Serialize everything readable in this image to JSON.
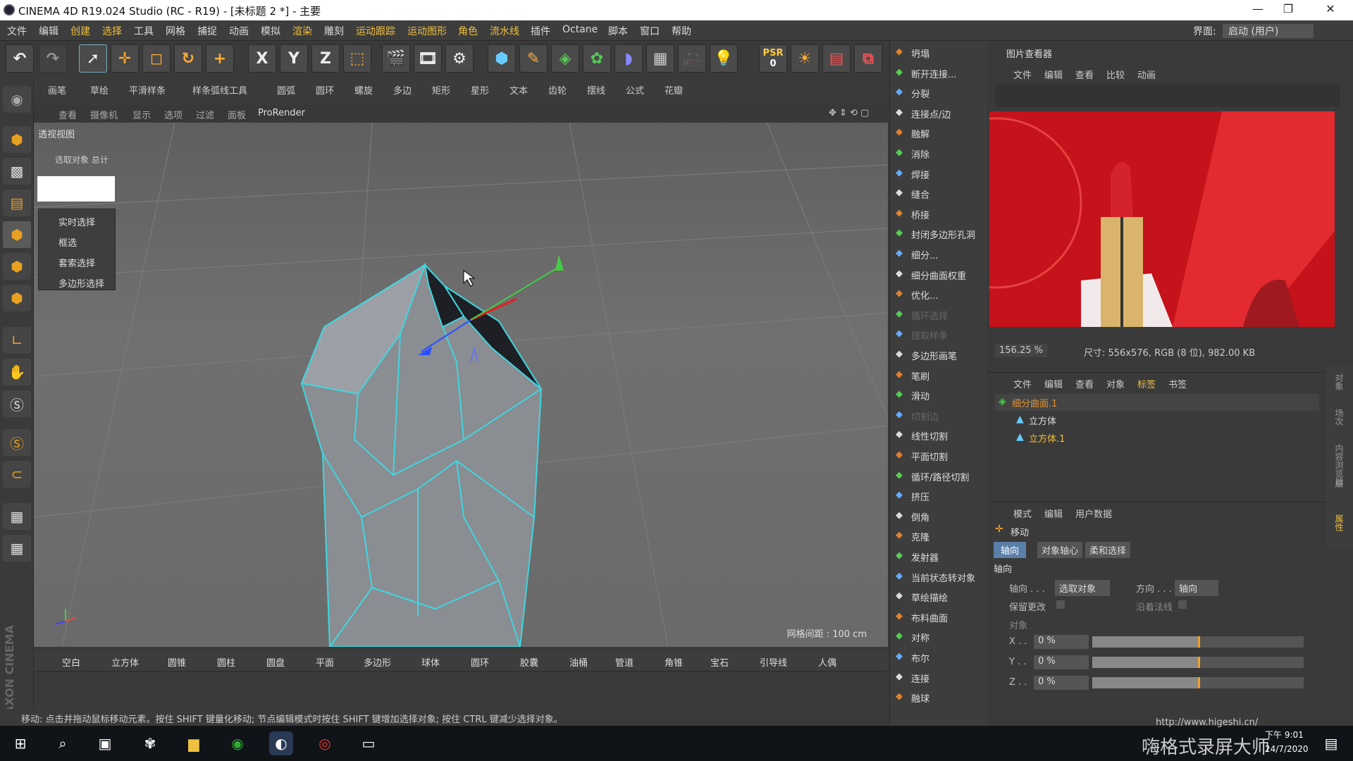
{
  "window": {
    "title": "CINEMA 4D R19.024 Studio (RC - R19) - [未标题 2 *] - 主要"
  },
  "menu": [
    "文件",
    "编辑",
    "创建",
    "选择",
    "工具",
    "网格",
    "捕捉",
    "动画",
    "模拟",
    "渲染",
    "雕刻",
    "运动跟踪",
    "运动图形",
    "角色",
    "流水线",
    "插件",
    "Octane",
    "脚本",
    "窗口",
    "帮助"
  ],
  "layout": {
    "label": "界面:",
    "value": "启动 (用户)"
  },
  "toolbar": {
    "psr_label": "PSR",
    "psr_value": "0",
    "axes": [
      "X",
      "Y",
      "Z"
    ]
  },
  "subbar": [
    "画笔",
    "草绘",
    "平滑样条",
    "样条弧线工具",
    "圆弧",
    "圆环",
    "螺旋",
    "多边",
    "矩形",
    "星形",
    "文本",
    "齿轮",
    "摆线",
    "公式",
    "花瓣"
  ],
  "viewport_menu": [
    "查看",
    "摄像机",
    "显示",
    "选项",
    "过滤",
    "面板",
    "ProRender"
  ],
  "viewport": {
    "label": "透视视图",
    "sel_header": "选取对象 总计",
    "select_menu": [
      "实时选择",
      "框选",
      "套索选择",
      "多边形选择"
    ],
    "grid_spacing": "网格间距 : 100 cm"
  },
  "object_bar": [
    "空白",
    "立方体",
    "圆锥",
    "圆柱",
    "圆盘",
    "平面",
    "多边形",
    "球体",
    "圆环",
    "胶囊",
    "油桶",
    "管道",
    "角锥",
    "宝石",
    "引导线",
    "人偶"
  ],
  "status_text": "移动: 点击并拖动鼠标移动元素。按住 SHIFT 键量化移动; 节点编辑模式时按住 SHIFT 键增加选择对象; 按住 CTRL 键减少选择对象。",
  "right_tools": [
    "坍塌",
    "断开连接...",
    "分裂",
    "连接点/边",
    "融解",
    "消除",
    "焊接",
    "缝合",
    "桥接",
    "封闭多边形孔洞",
    "细分...",
    "细分曲面权重",
    "优化...",
    "循环选择",
    "提取样条",
    "多边形画笔",
    "笔刷",
    "滑动",
    "切割边",
    "线性切割",
    "平面切割",
    "循环/路径切割",
    "挤压",
    "倒角",
    "克隆",
    "发射器",
    "当前状态转对象",
    "草绘描绘",
    "布料曲面",
    "对称",
    "布尔",
    "连接",
    "融球"
  ],
  "right_tools_disabled": [
    13,
    14,
    18
  ],
  "picture_viewer": {
    "title": "图片查看器",
    "menu": [
      "文件",
      "编辑",
      "查看",
      "比较",
      "动画"
    ],
    "zoom": "156.25 %",
    "size_info": "尺寸: 556x576, RGB (8 位), 982.00 KB"
  },
  "object_manager": {
    "menu": [
      "文件",
      "编辑",
      "查看",
      "对象",
      "标签",
      "书签"
    ],
    "items": [
      {
        "name": "细分曲面.1",
        "color": "#e09030"
      },
      {
        "name": "立方体",
        "color": "#dddddd"
      },
      {
        "name": "立方体.1",
        "color": "#f0c040"
      }
    ]
  },
  "attributes": {
    "menu": [
      "模式",
      "编辑",
      "用户数据"
    ],
    "tool_name": "移动",
    "tabs": [
      "轴向",
      "对象轴心",
      "柔和选择"
    ],
    "section": "轴向",
    "axis_label": "轴向 . . .",
    "axis_value": "选取对象",
    "direction_label": "方向 . . .",
    "direction_value": "轴向",
    "keep_label": "保留更改",
    "normal_label": "沿着法线",
    "object_label": "对象",
    "fields": [
      {
        "label": "X . .",
        "value": "0 %",
        "fill": 0.5
      },
      {
        "label": "Y . .",
        "value": "0 %",
        "fill": 0.5
      },
      {
        "label": "Z . .",
        "value": "0 %",
        "fill": 0.5
      }
    ]
  },
  "side_tabs": [
    "对象",
    "场次",
    "内容浏览器",
    "层",
    "属性"
  ],
  "taskbar": {
    "time": "下午 9:01",
    "date": "24/7/2020",
    "watermark": "嗨格式录屏大师",
    "watermark_url": "http://www.higeshi.cn/"
  }
}
